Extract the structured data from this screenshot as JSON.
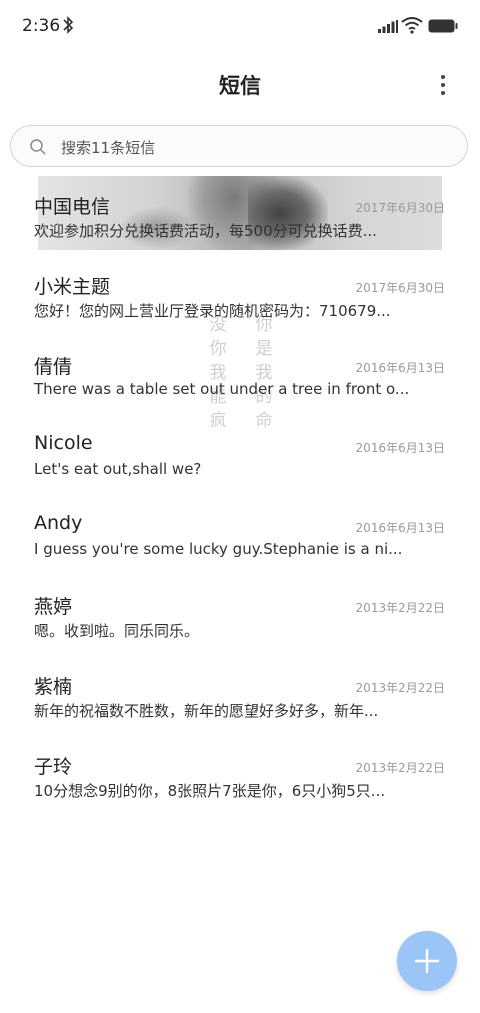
{
  "status_bar": {
    "time": "2:36",
    "icons": [
      "bluetooth-icon",
      "signal-icon",
      "wifi-icon",
      "battery-icon"
    ]
  },
  "header": {
    "title": "短信",
    "more_icon": "more-vertical-icon"
  },
  "search": {
    "placeholder": "搜索11条短信",
    "icon": "search-icon"
  },
  "conversations": [
    {
      "name": "中国电信",
      "date": "2017年6月30日",
      "preview": "欢迎参加积分兑换话费活动，每500分可兑换话费..."
    },
    {
      "name": "小米主题",
      "date": "2017年6月30日",
      "preview": "您好！您的网上营业厅登录的随机密码为：710679..."
    },
    {
      "name": "倩倩",
      "date": "2016年6月13日",
      "preview": "There was a table set out under a tree in front o..."
    },
    {
      "name": "Nicole",
      "date": "2016年6月13日",
      "preview": "Let's eat out,shall we?"
    },
    {
      "name": "Andy",
      "date": "2016年6月13日",
      "preview": "I guess you're some lucky guy.Stephanie is a ni..."
    },
    {
      "name": "燕婷",
      "date": "2013年2月22日",
      "preview": "嗯。收到啦。同乐同乐。"
    },
    {
      "name": "紫楠",
      "date": "2013年2月22日",
      "preview": "新年的祝福数不胜数，新年的愿望好多好多，新年..."
    },
    {
      "name": "子玲",
      "date": "2013年2月22日",
      "preview": "10分想念9别的你，8张照片7张是你，6只小狗5只..."
    }
  ],
  "watermark": {
    "left": "没你我能疯",
    "right": "你是我的命"
  },
  "fab": {
    "icon": "plus-icon",
    "color": "#9cc5f7"
  }
}
